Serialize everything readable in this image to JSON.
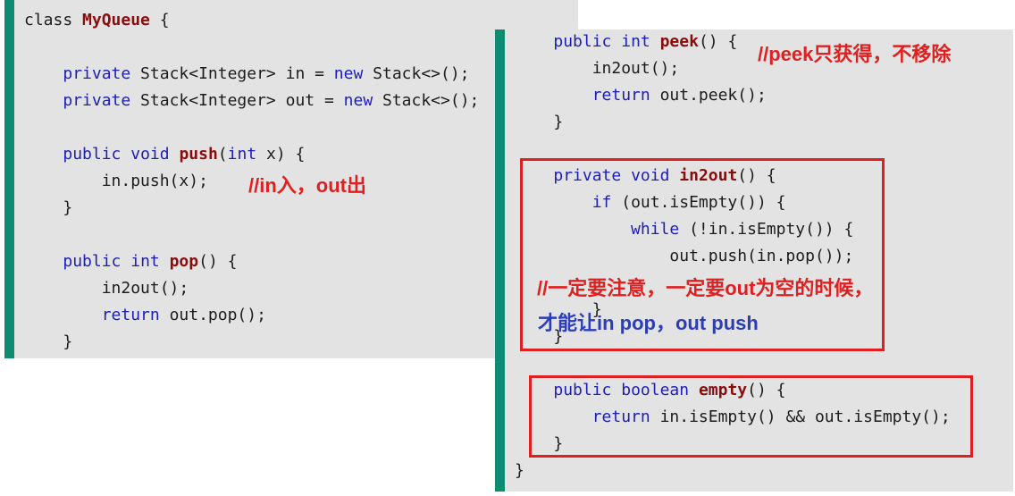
{
  "colors": {
    "keyword": "#1d1db8",
    "method": "#8a0d0d",
    "accent_bar": "#0e8c73",
    "annotation_red": "#e02020",
    "annotation_blue": "#2c3db8",
    "panel_bg": "#e3e3e3"
  },
  "left_code": [
    [
      [
        "pl",
        "class "
      ],
      [
        "fn",
        "MyQueue"
      ],
      [
        "pl",
        " {"
      ]
    ],
    [],
    [
      [
        "pl",
        "    "
      ],
      [
        "kw",
        "private"
      ],
      [
        "pl",
        " Stack<Integer> in = "
      ],
      [
        "kw",
        "new"
      ],
      [
        "pl",
        " Stack<>();"
      ]
    ],
    [
      [
        "pl",
        "    "
      ],
      [
        "kw",
        "private"
      ],
      [
        "pl",
        " Stack<Integer> out = "
      ],
      [
        "kw",
        "new"
      ],
      [
        "pl",
        " Stack<>();"
      ]
    ],
    [],
    [
      [
        "pl",
        "    "
      ],
      [
        "kw",
        "public"
      ],
      [
        "pl",
        " "
      ],
      [
        "kw",
        "void"
      ],
      [
        "pl",
        " "
      ],
      [
        "fn",
        "push"
      ],
      [
        "pl",
        "("
      ],
      [
        "kw",
        "int"
      ],
      [
        "pl",
        " x) {"
      ]
    ],
    [
      [
        "pl",
        "        in.push(x);"
      ]
    ],
    [
      [
        "pl",
        "    }"
      ]
    ],
    [],
    [
      [
        "pl",
        "    "
      ],
      [
        "kw",
        "public"
      ],
      [
        "pl",
        " "
      ],
      [
        "kw",
        "int"
      ],
      [
        "pl",
        " "
      ],
      [
        "fn",
        "pop"
      ],
      [
        "pl",
        "() {"
      ]
    ],
    [
      [
        "pl",
        "        in2out();"
      ]
    ],
    [
      [
        "pl",
        "        "
      ],
      [
        "kw",
        "return"
      ],
      [
        "pl",
        " out.pop();"
      ]
    ],
    [
      [
        "pl",
        "    }"
      ]
    ]
  ],
  "right_code": [
    [
      [
        "pl",
        "    "
      ],
      [
        "kw",
        "public"
      ],
      [
        "pl",
        " "
      ],
      [
        "kw",
        "int"
      ],
      [
        "pl",
        " "
      ],
      [
        "fn",
        "peek"
      ],
      [
        "pl",
        "() {"
      ]
    ],
    [
      [
        "pl",
        "        in2out();"
      ]
    ],
    [
      [
        "pl",
        "        "
      ],
      [
        "kw",
        "return"
      ],
      [
        "pl",
        " out.peek();"
      ]
    ],
    [
      [
        "pl",
        "    }"
      ]
    ],
    [],
    [
      [
        "pl",
        "    "
      ],
      [
        "kw",
        "private"
      ],
      [
        "pl",
        " "
      ],
      [
        "kw",
        "void"
      ],
      [
        "pl",
        " "
      ],
      [
        "fn",
        "in2out"
      ],
      [
        "pl",
        "() {"
      ]
    ],
    [
      [
        "pl",
        "        "
      ],
      [
        "kw",
        "if"
      ],
      [
        "pl",
        " (out.isEmpty()) {"
      ]
    ],
    [
      [
        "pl",
        "            "
      ],
      [
        "kw",
        "while"
      ],
      [
        "pl",
        " (!in.isEmpty()) {"
      ]
    ],
    [
      [
        "pl",
        "                out.push(in.pop());"
      ]
    ],
    [],
    [
      [
        "pl",
        "        }"
      ]
    ],
    [
      [
        "pl",
        "    }"
      ]
    ],
    [],
    [
      [
        "pl",
        "    "
      ],
      [
        "kw",
        "public"
      ],
      [
        "pl",
        " "
      ],
      [
        "kw",
        "boolean"
      ],
      [
        "pl",
        " "
      ],
      [
        "fn",
        "empty"
      ],
      [
        "pl",
        "() {"
      ]
    ],
    [
      [
        "pl",
        "        "
      ],
      [
        "kw",
        "return"
      ],
      [
        "pl",
        " in.isEmpty() && out.isEmpty();"
      ]
    ],
    [
      [
        "pl",
        "    }"
      ]
    ],
    [
      [
        "pl",
        "}"
      ]
    ]
  ],
  "annotations": {
    "in_out": "//in入，out出",
    "peek": "//peek只获得，不移除",
    "careful": "//一定要注意，一定要out为空的时候，",
    "pop_push": "才能让in pop，out push"
  }
}
